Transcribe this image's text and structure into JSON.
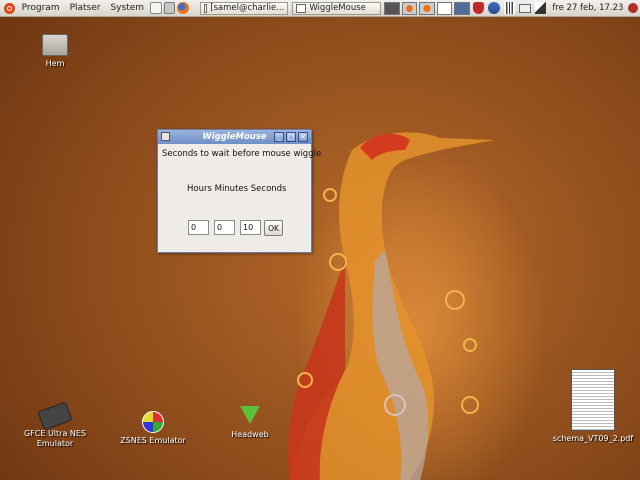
{
  "panel": {
    "menus": [
      "Program",
      "Platser",
      "System"
    ],
    "tasks": [
      {
        "label": "[samel@charlie..."
      },
      {
        "label": "WiggleMouse"
      }
    ],
    "clock": "fre 27 feb, 17.23"
  },
  "desktop": {
    "icons": [
      {
        "label": "Hem"
      },
      {
        "label": "GFCE Ultra NES Emulator"
      },
      {
        "label": "ZSNES Emulator"
      },
      {
        "label": "Headweb"
      },
      {
        "label": "schema_VT09_2.pdf"
      }
    ]
  },
  "dialog": {
    "title": "WiggleMouse",
    "prompt": "Seconds to wait before mouse wiggle",
    "units": "Hours Minutes Seconds",
    "hours": "0",
    "minutes": "0",
    "seconds": "10",
    "ok_label": "OK"
  },
  "colors": {
    "desktop_bg": "#8f4d1c",
    "titlebar": "#7f9dd0",
    "ubuntu_orange": "#dd4814"
  }
}
